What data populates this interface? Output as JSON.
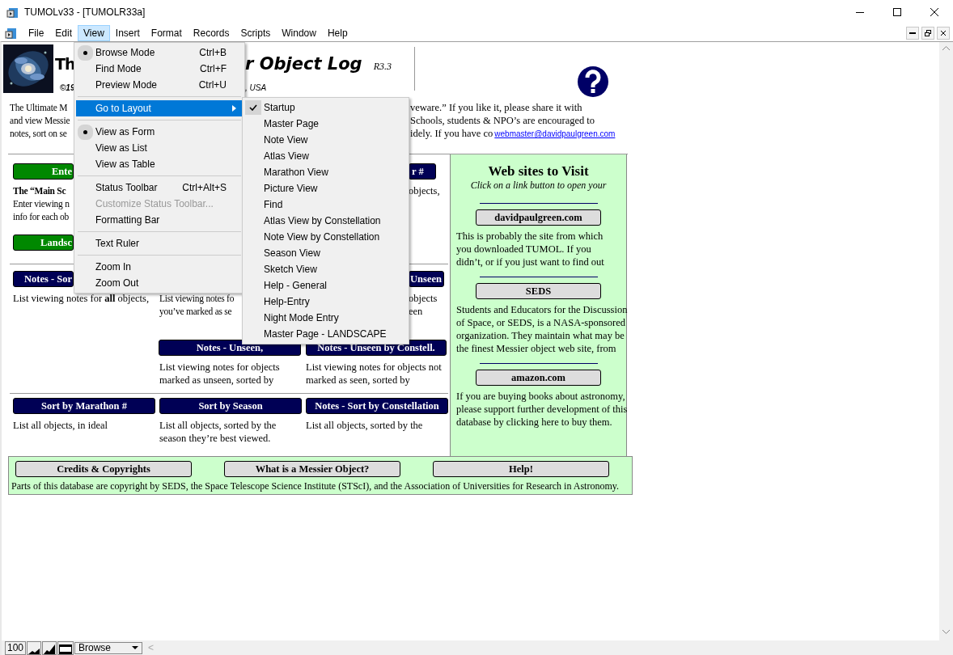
{
  "window": {
    "title": "TUMOLv33 - [TUMOLR33a]"
  },
  "menubar": [
    {
      "label": "File",
      "selected": false
    },
    {
      "label": "Edit",
      "selected": false
    },
    {
      "label": "View",
      "selected": true
    },
    {
      "label": "Insert",
      "selected": false
    },
    {
      "label": "Format",
      "selected": false
    },
    {
      "label": "Records",
      "selected": false
    },
    {
      "label": "Scripts",
      "selected": false
    },
    {
      "label": "Window",
      "selected": false
    },
    {
      "label": "Help",
      "selected": false
    }
  ],
  "form": {
    "header": {
      "title_left": "Th",
      "title_right": "r Object Log",
      "release": "R3.3",
      "copyright_left": "©19",
      "copyright_right": ", USA"
    },
    "intro_left": [
      "The Ultimate M",
      "and view Messie",
      "notes, sort on se"
    ],
    "intro_right": [
      "veware.” If you like it, please share it with",
      "Schools, students & NPO’s are encouraged to",
      "idely. If you have co"
    ],
    "email": "webmaster@davidpaulgreen.com",
    "rows": [
      [
        {
          "items": [
            {
              "kind": "green",
              "label": "Ente"
            },
            {
              "kind": "heading",
              "text": "The “Main Sc"
            },
            {
              "kind": "text",
              "text": "Enter viewing n"
            },
            {
              "kind": "text",
              "text": "info for each ob"
            },
            {
              "kind": "green",
              "label": "Landsc"
            }
          ]
        },
        {},
        {
          "items": [
            {
              "kind": "navy",
              "label": "r #"
            },
            {
              "kind": "text",
              "text": "objects,"
            }
          ]
        }
      ],
      [
        {
          "items": [
            {
              "kind": "navy",
              "label": "Notes - Sor"
            },
            {
              "kind": "text",
              "text": "List viewing notes for **all** objects,"
            }
          ]
        },
        {
          "items": [
            {
              "kind": "text",
              "text": "List viewing notes fo"
            },
            {
              "kind": "text",
              "text": "you’ve marked as se"
            }
          ]
        },
        {
          "items": [
            {
              "kind": "navy",
              "label": "Unseen"
            },
            {
              "kind": "text",
              "text": "objects"
            },
            {
              "kind": "text",
              "text": "een"
            }
          ]
        }
      ],
      [
        {},
        {
          "items": [
            {
              "kind": "navy",
              "label": "Notes - Unseen,"
            },
            {
              "kind": "text",
              "text": "List viewing notes for objects"
            },
            {
              "kind": "text",
              "text": "marked as unseen, sorted by"
            }
          ]
        },
        {
          "items": [
            {
              "kind": "navy",
              "label": "Notes - Unseen by Constell."
            },
            {
              "kind": "text",
              "text": "List viewing notes for objects not"
            },
            {
              "kind": "text",
              "text": "marked as seen, sorted by"
            }
          ]
        }
      ],
      [
        {
          "items": [
            {
              "kind": "navy",
              "label": "Sort by Marathon #"
            },
            {
              "kind": "text",
              "text": "List all objects, in ideal"
            }
          ]
        },
        {
          "items": [
            {
              "kind": "navy",
              "label": "Sort by Season"
            },
            {
              "kind": "text",
              "text": "List all objects, sorted by the"
            },
            {
              "kind": "text",
              "text": "season they’re best viewed."
            }
          ]
        },
        {
          "items": [
            {
              "kind": "navy",
              "label": "Notes - Sort by Constellation"
            },
            {
              "kind": "text",
              "text": "List all objects, sorted by the"
            }
          ]
        }
      ]
    ],
    "websites": {
      "title": "Web sites to Visit",
      "subtitle": "Click on a link button to open your",
      "sites": [
        {
          "button": "davidpaulgreen.com",
          "lines": [
            "This is probably the site from which",
            "you downloaded TUMOL. If you",
            "didn’t, or if you just want to find out"
          ]
        },
        {
          "button": "SEDS",
          "lines": [
            "Students and Educators for the Discussion",
            "of Space, or SEDS, is a NASA-sponsored",
            "organization. They maintain what may be",
            "the finest Messier object web site, from"
          ]
        },
        {
          "button": "amazon.com",
          "lines": [
            "If you are buying books about astronomy,",
            "please support further development of this",
            "database by clicking here to buy them."
          ]
        }
      ]
    },
    "footer": {
      "buttons": [
        "Credits & Copyrights",
        "What is a Messier Object?",
        "Help!"
      ],
      "note": "Parts of this database are copyright by SEDS, the Space Telescope Science Institute (STScI), and the Association of  Universities for Research in Astronomy."
    }
  },
  "view_menu": [
    {
      "kind": "item",
      "label": "Browse Mode",
      "shortcut": "Ctrl+B",
      "checked": true,
      "disabled": false,
      "submenu": false,
      "selected": false
    },
    {
      "kind": "item",
      "label": "Find Mode",
      "shortcut": "Ctrl+F",
      "checked": false,
      "disabled": false,
      "submenu": false,
      "selected": false
    },
    {
      "kind": "item",
      "label": "Preview Mode",
      "shortcut": "Ctrl+U",
      "checked": false,
      "disabled": false,
      "submenu": false,
      "selected": false
    },
    {
      "kind": "separator"
    },
    {
      "kind": "item",
      "label": "Go to Layout",
      "checked": false,
      "disabled": false,
      "submenu": true,
      "selected": true
    },
    {
      "kind": "separator"
    },
    {
      "kind": "item",
      "label": "View as Form",
      "checked": true,
      "disabled": false,
      "submenu": false,
      "selected": false
    },
    {
      "kind": "item",
      "label": "View as List",
      "checked": false,
      "disabled": false,
      "submenu": false,
      "selected": false
    },
    {
      "kind": "item",
      "label": "View as Table",
      "checked": false,
      "disabled": false,
      "submenu": false,
      "selected": false
    },
    {
      "kind": "separator"
    },
    {
      "kind": "item",
      "label": "Status Toolbar",
      "shortcut": "Ctrl+Alt+S",
      "checked": false,
      "disabled": false,
      "submenu": false,
      "selected": false
    },
    {
      "kind": "item",
      "label": "Customize Status Toolbar...",
      "checked": false,
      "disabled": true,
      "submenu": false,
      "selected": false
    },
    {
      "kind": "item",
      "label": "Formatting Bar",
      "checked": false,
      "disabled": false,
      "submenu": false,
      "selected": false
    },
    {
      "kind": "separator"
    },
    {
      "kind": "item",
      "label": "Text Ruler",
      "checked": false,
      "disabled": false,
      "submenu": false,
      "selected": false
    },
    {
      "kind": "separator"
    },
    {
      "kind": "item",
      "label": "Zoom In",
      "checked": false,
      "disabled": false,
      "submenu": false,
      "selected": false
    },
    {
      "kind": "item",
      "label": "Zoom Out",
      "checked": false,
      "disabled": false,
      "submenu": false,
      "selected": false
    }
  ],
  "layout_menu": [
    {
      "label": "Startup",
      "checked": true
    },
    {
      "label": "Master Page",
      "checked": false
    },
    {
      "label": "Note View",
      "checked": false
    },
    {
      "label": "Atlas View",
      "checked": false
    },
    {
      "label": "Marathon View",
      "checked": false
    },
    {
      "label": "Picture View",
      "checked": false
    },
    {
      "label": "Find",
      "checked": false
    },
    {
      "label": "Atlas View by Constellation",
      "checked": false
    },
    {
      "label": "Note View by Constellation",
      "checked": false
    },
    {
      "label": "Season View",
      "checked": false
    },
    {
      "label": "Sketch View",
      "checked": false
    },
    {
      "label": "Help - General",
      "checked": false
    },
    {
      "label": "Help-Entry",
      "checked": false
    },
    {
      "label": "Night Mode Entry",
      "checked": false
    },
    {
      "label": "Master Page - LANDSCAPE",
      "checked": false
    }
  ],
  "status_bar": {
    "zoom": "100",
    "mode": "Browse",
    "scroll_arrow": "<"
  }
}
